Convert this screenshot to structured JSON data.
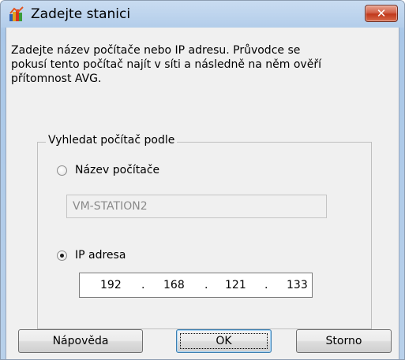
{
  "window": {
    "title": "Zadejte stanici",
    "close_symbol": "✕"
  },
  "description": "Zadejte název počítače nebo IP adresu. Průvodce se\npokusí tento počítač najít v síti a následně na něm ověří\npřítomnost AVG.",
  "group": {
    "legend": "Vyhledat počítač podle",
    "options": [
      {
        "label": "Název počítače",
        "checked": false
      },
      {
        "label": "IP adresa",
        "checked": true
      }
    ],
    "computer_name_value": "VM-STATION2",
    "ip_octets": [
      "192",
      "168",
      "121",
      "133"
    ],
    "ip_separator": "."
  },
  "buttons": {
    "help": "Nápověda",
    "ok": "OK",
    "cancel": "Storno"
  },
  "icons": {
    "app_icon": "avg-logo-icon",
    "close_icon": "close-icon"
  },
  "colors": {
    "close_button": "#c1391c",
    "title_bar": "#b3cdea",
    "client_bg": "#f0f0f0"
  }
}
